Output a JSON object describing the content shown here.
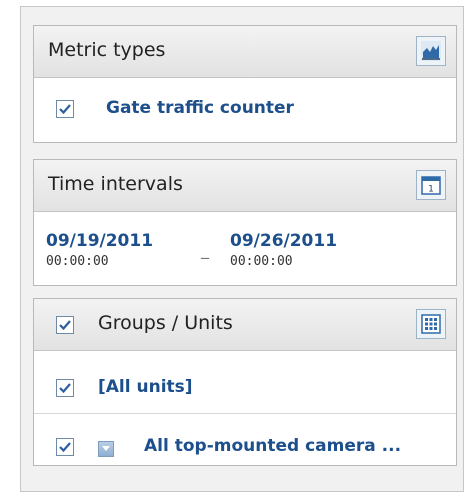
{
  "metric_types": {
    "title": "Metric types",
    "icon": "chart-icon",
    "items": [
      {
        "label": "Gate traffic counter",
        "checked": true
      }
    ]
  },
  "time_intervals": {
    "title": "Time intervals",
    "icon": "calendar-icon",
    "start_date": "09/19/2011",
    "start_time": "00:00:00",
    "separator": "_",
    "end_date": "09/26/2011",
    "end_time": "00:00:00"
  },
  "groups_units": {
    "title": "Groups / Units",
    "header_checked": true,
    "icon": "grid-icon",
    "all_units_label": "[All units]",
    "all_units_checked": true,
    "group_label": "All top-mounted camera ...",
    "group_checked": true
  },
  "colors": {
    "link_blue": "#1d4f8c",
    "check_blue": "#2b5f9e"
  }
}
